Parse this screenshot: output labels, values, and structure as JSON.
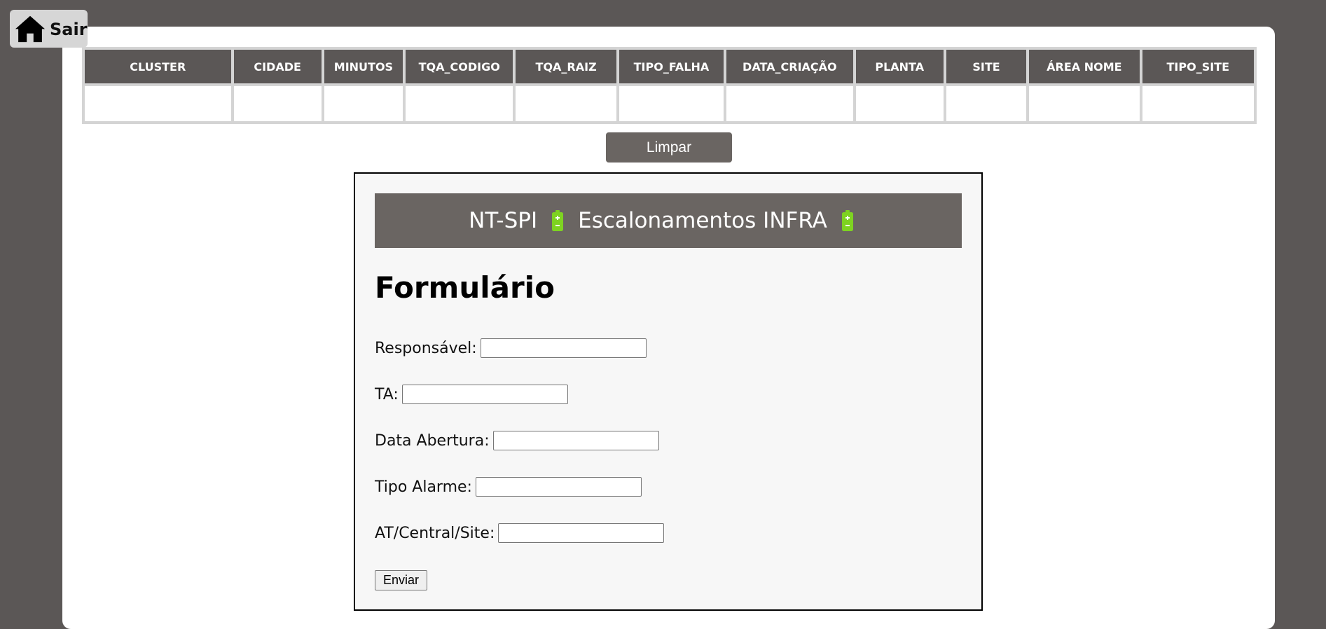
{
  "home": {
    "label": "Sair",
    "icon": "home-icon"
  },
  "table": {
    "headers": [
      "CLUSTER",
      "CIDADE",
      "MINUTOS",
      "TQA_CODIGO",
      "TQA_RAIZ",
      "TIPO_FALHA",
      "DATA_CRIAÇÃO",
      "PLANTA",
      "SITE",
      "ÁREA NOME",
      "TIPO_SITE"
    ]
  },
  "limpar_label": "Limpar",
  "form": {
    "header_left": "NT-SPI",
    "header_right": "Escalonamentos INFRA",
    "header_icon": "battery-icon",
    "title": "Formulário",
    "fields": [
      {
        "label": "Responsável:",
        "value": ""
      },
      {
        "label": "TA:",
        "value": ""
      },
      {
        "label": "Data Abertura:",
        "value": ""
      },
      {
        "label": "Tipo Alarme:",
        "value": ""
      },
      {
        "label": "AT/Central/Site:",
        "value": ""
      }
    ],
    "submit_label": "Enviar"
  },
  "colors": {
    "background": "#5b5756",
    "header_bar": "#6a6562",
    "battery_green": "#7ed321"
  }
}
